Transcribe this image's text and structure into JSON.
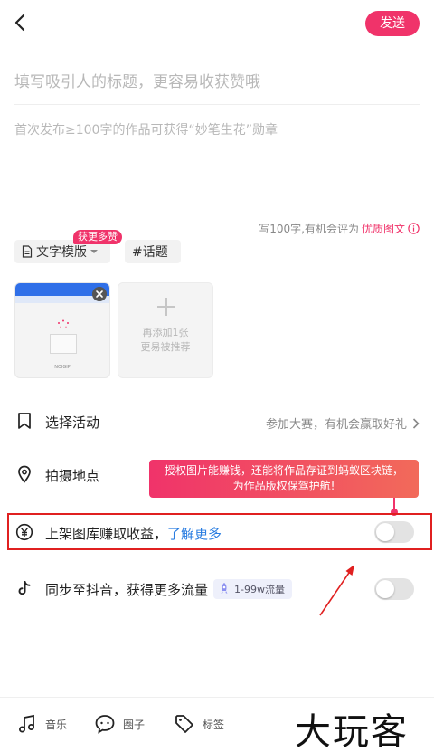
{
  "header": {
    "send_label": "发送"
  },
  "editor": {
    "title_placeholder": "填写吸引人的标题，更容易收获赞哦",
    "body_placeholder": "首次发布≥100字的作品可获得“妙笔生花”勋章"
  },
  "hint": {
    "prefix": "写100字,有机会评为",
    "highlight": "优质图文"
  },
  "chips": {
    "template_label": "文字模版",
    "badge_label": "获更多赞",
    "topic_label": "#话题"
  },
  "images": {
    "thumb_footer": "NOIGIP",
    "add_line1": "再添加1张",
    "add_line2": "更易被推荐"
  },
  "rows": {
    "activity_label": "选择活动",
    "activity_hint": "参加大赛，有机会赢取好礼",
    "location_label": "拍摄地点",
    "gallery_label": "上架图库赚取收益，",
    "gallery_link": "了解更多",
    "douyin_label": "同步至抖音，获得更多流量",
    "douyin_badge": "1-99w流量"
  },
  "tooltip": {
    "line1": "授权图片能赚钱，还能将作品存证到蚂蚁区块链，",
    "line2": "为作品版权保驾护航!"
  },
  "bottom": {
    "music": "音乐",
    "circle": "圈子",
    "tag": "标签"
  },
  "watermark": "大玩客",
  "colors": {
    "accent": "#f0336a",
    "link": "#2a7de1",
    "highlight_box": "#e02020"
  }
}
